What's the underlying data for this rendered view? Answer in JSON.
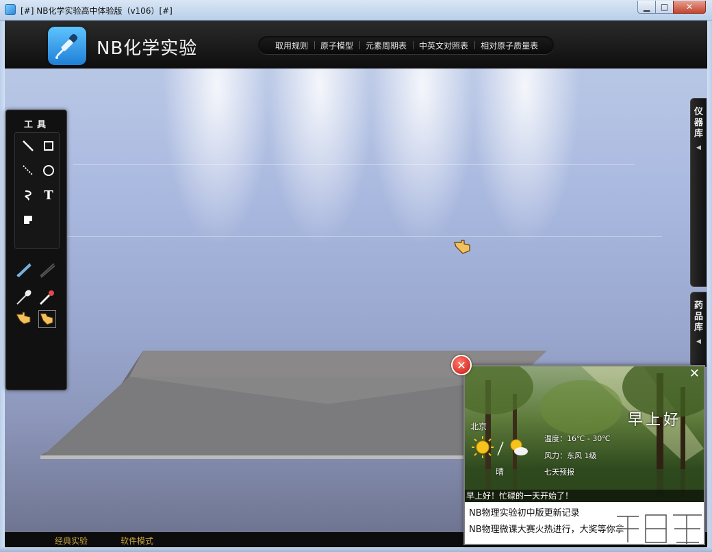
{
  "window": {
    "title": "[#] NB化学实验高中体验版（v106）[#]",
    "minimize_symbol": "▁",
    "maximize_symbol": "□",
    "close_symbol": "✕"
  },
  "header": {
    "brand": "NB化学实验",
    "menu": [
      "取用规则",
      "原子模型",
      "元素周期表",
      "中英文对照表",
      "相对原子质量表"
    ]
  },
  "tools": {
    "title": "工具",
    "drawing": [
      {
        "icon": "line-icon"
      },
      {
        "icon": "rectangle-icon"
      },
      {
        "icon": "dashed-line-icon"
      },
      {
        "icon": "circle-icon"
      },
      {
        "icon": "curve-icon"
      },
      {
        "icon": "text-icon",
        "glyph": "T"
      },
      {
        "icon": "fill-icon"
      }
    ],
    "lab_tools": [
      {
        "icon": "tweezers-icon"
      },
      {
        "icon": "tongs-icon"
      },
      {
        "icon": "spoon-icon"
      },
      {
        "icon": "dropper-icon"
      },
      {
        "icon": "hand-icon"
      },
      {
        "icon": "hand-pour-icon"
      }
    ]
  },
  "side_tabs": [
    {
      "label": "仪器库",
      "arrow": "◀"
    },
    {
      "label": "药品库",
      "arrow": "◀"
    }
  ],
  "bottom": {
    "links": [
      "经典实验",
      "软件模式"
    ]
  },
  "popup": {
    "close_symbol": "✕",
    "badge_symbol": "✕",
    "greeting_big": "早上好",
    "city": "北京",
    "weather": "晴",
    "temperature": "温度：16℃ - 30℃",
    "wind": "风力：东风 1级",
    "forecast": "七天预报",
    "greeting_line": "早上好！忙碌的一天开始了！",
    "news": [
      "NB物理实验初中版更新记录",
      "NB物理微课大赛火热进行，大奖等你拿"
    ]
  },
  "colors": {
    "bottom_link": "#c8a640",
    "header_bg": "#0e0e0e",
    "accent_blue": "#2a88d8"
  }
}
